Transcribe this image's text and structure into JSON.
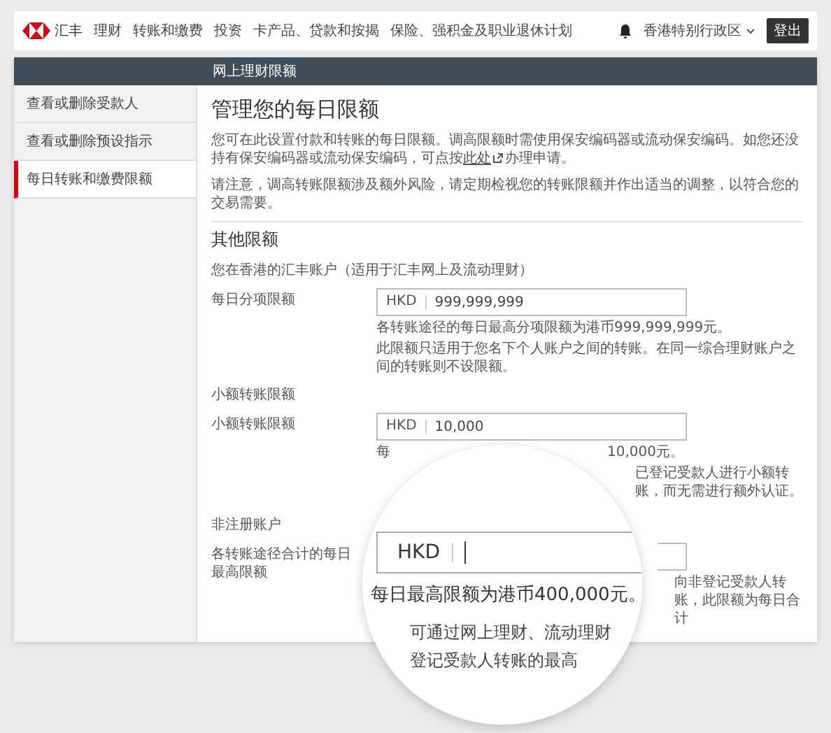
{
  "nav": {
    "logo": "汇丰",
    "items": [
      {
        "label": "理财"
      },
      {
        "label": "转账和缴费"
      },
      {
        "label": "投资"
      },
      {
        "label": "卡产品、贷款和按揭"
      },
      {
        "label": "保险、强积金及职业退休计划"
      }
    ],
    "region": "香港特别行政区",
    "logout": "登出"
  },
  "panel_title": "网上理财限额",
  "sidebar": {
    "items": [
      {
        "label": "查看或删除受款人",
        "selected": false
      },
      {
        "label": "查看或删除预设指示",
        "selected": false
      },
      {
        "label": "每日转账和缴费限额",
        "selected": true
      }
    ]
  },
  "page_title": "管理您的每日限额",
  "intro": {
    "before": "您可在此设置付款和转账的每日限额。调高限额时需使用保安编码器或流动保安编码。如您还没持有保安编码器或流动保安编码，可点按",
    "link": "此处",
    "after": "办理申请。"
  },
  "notice": "请注意，调高转账限额涉及额外风险，请定期检视您的转账限额并作出适当的调整，以符合您的交易需要。",
  "section_title": "其他限额",
  "account_scope": "您在香港的汇丰账户（适用于汇丰网上及流动理财）",
  "groups": [
    {
      "rows": [
        {
          "label": "每日分项限额",
          "currency": "HKD",
          "value": "999,999,999",
          "notes": [
            {
              "kind": "full",
              "text": "各转账途径的每日最高分项限额为港币999,999,999元。"
            },
            {
              "kind": "full",
              "text": "此限额只适用于您名下个人账户之间的转账。在同一综合理财账户之间的转账则不设限额。"
            }
          ]
        }
      ]
    },
    {
      "heading": "小额转账限额",
      "rows": [
        {
          "label": "小额转账限额",
          "currency": "HKD",
          "value": "10,000",
          "notes": [
            {
              "kind": "split",
              "head": "每",
              "tail": "10,000元。"
            },
            {
              "kind": "tail",
              "tail": "已登记受款人进行小额转账，而无需进行额外认证。"
            }
          ]
        }
      ]
    },
    {
      "heading": "非注册账户",
      "rows": [
        {
          "label": "各转账途径合计的每日最高限额",
          "notes": [
            {
              "kind": "tail",
              "tail": "向非登记受款人转账，此限额为每日合计"
            }
          ],
          "magnifier": {
            "currency": "HKD",
            "lines": [
              "每日最高限额为港币400,000元。",
              "可通过网上理财、流动理财",
              "登记受款人转账的最高"
            ]
          }
        }
      ]
    }
  ]
}
